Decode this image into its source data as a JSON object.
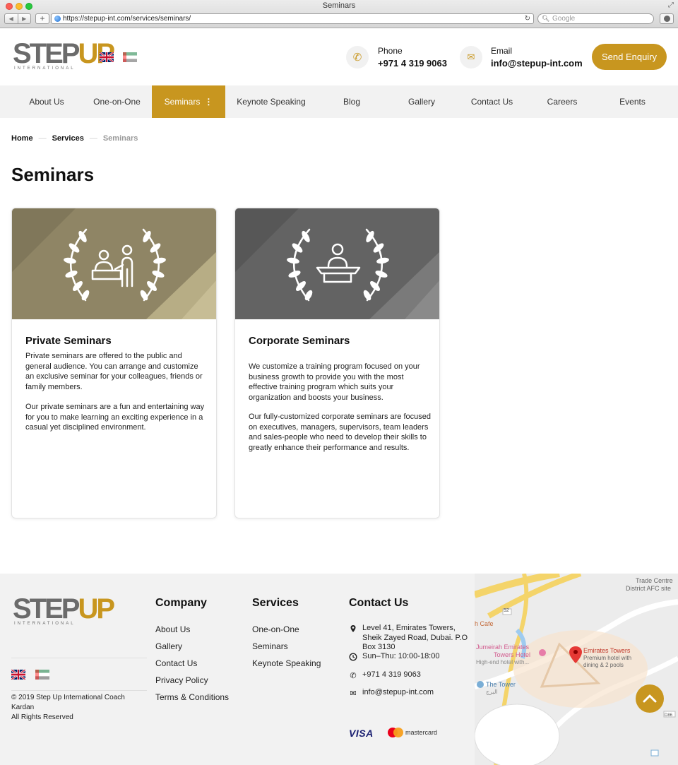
{
  "browser": {
    "window_title": "Seminars",
    "url": "https://stepup-int.com/services/seminars/",
    "search_placeholder": "Google"
  },
  "header": {
    "logo": {
      "word": "STEP",
      "accent": "UP",
      "tagline": "INTERNATIONAL"
    },
    "phone": {
      "label": "Phone",
      "value": "+971 4 319 9063",
      "icon": "phone-icon"
    },
    "email": {
      "label": "Email",
      "value": "info@stepup-int.com",
      "icon": "envelope-icon"
    },
    "enquiry_label": "Send Enquiry"
  },
  "nav": {
    "items": [
      {
        "label": "About Us"
      },
      {
        "label": "One-on-One"
      },
      {
        "label": "Seminars",
        "active": true,
        "icon": "kebab-icon"
      },
      {
        "label": "Keynote Speaking"
      },
      {
        "label": "Blog"
      },
      {
        "label": "Gallery"
      },
      {
        "label": "Contact Us"
      },
      {
        "label": "Careers"
      },
      {
        "label": "Events"
      }
    ]
  },
  "breadcrumb": {
    "home": "Home",
    "services": "Services",
    "current": "Seminars"
  },
  "page": {
    "title": "Seminars",
    "cards": [
      {
        "title": "Private Seminars",
        "icon": "laurel-presenter-icon",
        "p1": "Private seminars are offered to the public and general audience. You can arrange and customize an exclusive seminar for your colleagues, friends or family members.",
        "p2": "Our private seminars are a fun and entertaining way for you to make learning an exciting experience in a casual yet disciplined environment."
      },
      {
        "title": "Corporate Seminars",
        "icon": "laurel-podium-icon",
        "p1": "We customize a training program focused on your business growth to provide you with the most effective training program which suits your organization and boosts your business.",
        "p2": "Our fully-customized corporate seminars are focused on executives, managers, supervisors, team leaders and sales-people who need to develop their skills to greatly enhance their performance and results."
      }
    ]
  },
  "footer": {
    "copyright": "© 2019 Step Up International Coach Kardan",
    "rights": "All Rights Reserved",
    "company": {
      "title": "Company",
      "links": [
        "About Us",
        "Gallery",
        "Contact Us",
        "Privacy Policy",
        "Terms & Conditions"
      ]
    },
    "services": {
      "title": "Services",
      "links": [
        "One-on-One",
        "Seminars",
        "Keynote Speaking"
      ]
    },
    "contact": {
      "title": "Contact Us",
      "address": "Level 41, Emirates Towers, Sheik Zayed Road, Dubai. P.O Box 3130",
      "hours": "Sun–Thu: 10:00-18:00",
      "phone": "+971 4 319 9063",
      "email": "info@stepup-int.com"
    },
    "payments": {
      "visa": "VISA",
      "mastercard": "mastercard"
    }
  },
  "map": {
    "labels": {
      "trade_centre": "Trade Centre",
      "afc": "District AFC site",
      "cafe": "h Cafe",
      "jumeirah": "Jumeirah Emirates",
      "jumeirah2": "Towers Hotel",
      "jumeirah_desc": "High-end hotel with...",
      "emirates_towers": "Emirates Towers",
      "emirates_desc1": "Premium hotel with",
      "emirates_desc2": "dining & 2 pools",
      "the_tower": "The Tower",
      "arabic": "البرج",
      "road_52": "52",
      "road_d86": "D86"
    }
  },
  "colors": {
    "accent": "#c8961f",
    "nav_bg": "#f2f2f2",
    "footer_bg": "#f2f2f2",
    "card1_bg": "#8f8565",
    "card2_bg": "#636363"
  }
}
